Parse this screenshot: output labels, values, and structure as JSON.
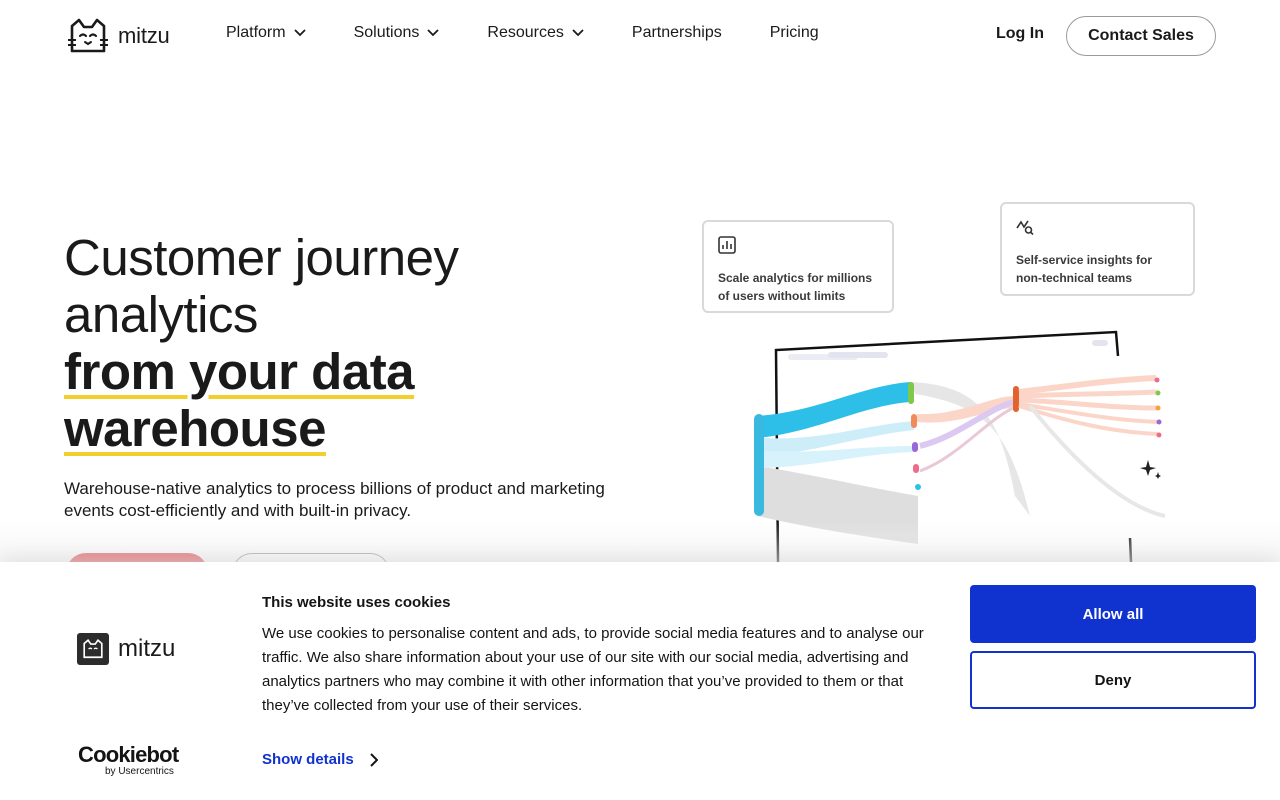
{
  "header": {
    "logo_text": "mitzu",
    "nav": [
      {
        "label": "Platform",
        "has_dropdown": true
      },
      {
        "label": "Solutions",
        "has_dropdown": true
      },
      {
        "label": "Resources",
        "has_dropdown": true
      },
      {
        "label": "Partnerships",
        "has_dropdown": false
      },
      {
        "label": "Pricing",
        "has_dropdown": false
      }
    ],
    "login_label": "Log In",
    "contact_label": "Contact Sales"
  },
  "hero": {
    "title_line1": "Customer journey",
    "title_line2": "analytics",
    "title_hl1": "from your data",
    "title_hl2": "warehouse",
    "subtitle": "Warehouse-native analytics to process billions of product and marketing events cost-efficiently and with built-in privacy.",
    "illustration": {
      "card1_text": "Scale analytics for millions of users without limits",
      "card1_icon": "chart-icon",
      "card2_text": "Self-service insights for non-technical teams",
      "card2_icon": "insights-search-icon"
    }
  },
  "cookie_banner": {
    "logo_text": "mitzu",
    "title": "This website uses cookies",
    "body": "We use cookies to personalise content and ads, to provide social media features and to analyse our traffic. We also share information about your use of our site with our social media, advertising and analytics partners who may combine it with other information that you’ve provided to them or that they’ve collected from your use of their services.",
    "show_details_label": "Show details",
    "allow_label": "Allow all",
    "deny_label": "Deny",
    "cookiebot_brand": "Cookiebot",
    "cookiebot_by": "by Usercentrics"
  },
  "colors": {
    "accent_blue": "#1032cf",
    "cta_red": "#e34b55",
    "highlight_yellow": "#f2cf2b"
  }
}
